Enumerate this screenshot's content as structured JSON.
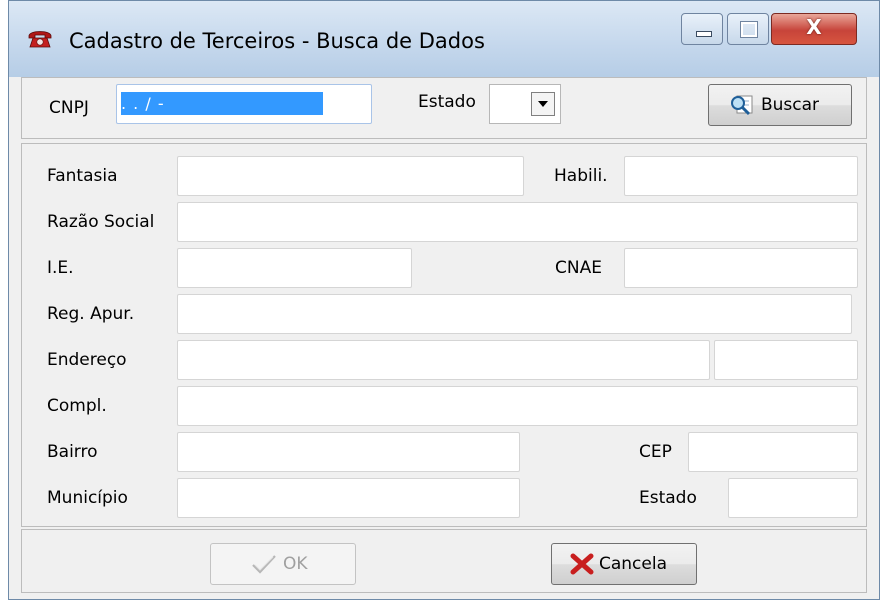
{
  "window": {
    "title": "Cadastro de Terceiros - Busca de Dados",
    "close_glyph": "X",
    "colors": {
      "selection": "#3399ff",
      "close_button": "#c7443a",
      "cancel_icon": "#c81e1e"
    }
  },
  "search": {
    "cnpj_label": "CNPJ",
    "cnpj_value": " .   .   /     -",
    "estado_label": "Estado",
    "estado_value": "",
    "buscar_label": "Buscar",
    "buscar_icon": "search-magnifier-icon"
  },
  "form": {
    "fantasia_label": "Fantasia",
    "habili_label": "Habili.",
    "razao_social_label": "Razão Social",
    "ie_label": "I.E.",
    "cnae_label": "CNAE",
    "reg_apur_label": "Reg. Apur.",
    "endereco_label": "Endereço",
    "compl_label": "Compl.",
    "bairro_label": "Bairro",
    "cep_label": "CEP",
    "municipio_label": "Município",
    "estado_label": "Estado"
  },
  "footer": {
    "ok_label": "OK",
    "ok_enabled": false,
    "cancel_label": "Cancela"
  }
}
